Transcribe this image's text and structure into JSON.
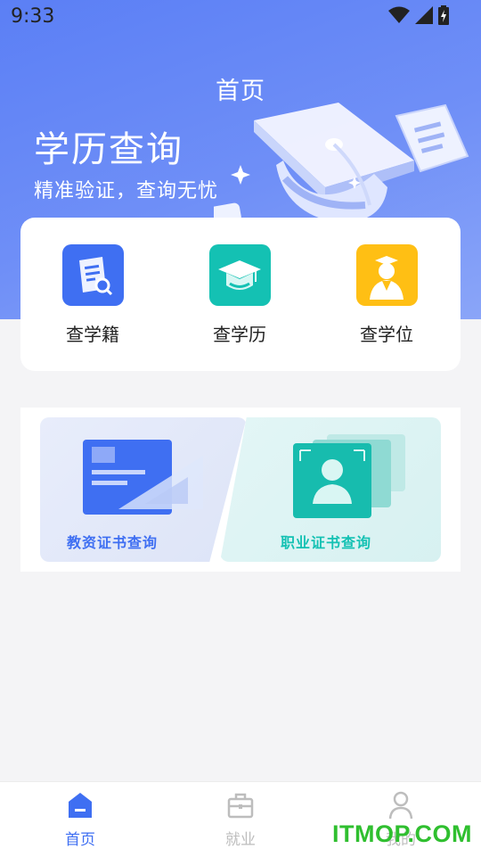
{
  "status_bar": {
    "time": "9:33"
  },
  "header": {
    "title": "首页"
  },
  "hero": {
    "title": "学历查询",
    "subtitle": "精准验证，查询无忧"
  },
  "quick_entries": [
    {
      "label": "查学籍",
      "icon": "document-search-icon",
      "color": "#3f6ff2"
    },
    {
      "label": "查学历",
      "icon": "graduation-cap-icon",
      "color": "#14c1b3"
    },
    {
      "label": "查学位",
      "icon": "graduate-person-icon",
      "color": "#ffbf14"
    }
  ],
  "banners": [
    {
      "label": "教资证书查询",
      "color": "#3f6ff2"
    },
    {
      "label": "职业证书查询",
      "color": "#14c1b3"
    }
  ],
  "tabbar": {
    "items": [
      {
        "label": "首页",
        "icon": "home-icon",
        "active": true
      },
      {
        "label": "就业",
        "icon": "briefcase-icon",
        "active": false
      },
      {
        "label": "我的",
        "icon": "person-icon",
        "active": false
      }
    ],
    "active_color": "#3f6ff2",
    "inactive_color": "#bdbdbd"
  },
  "watermark": "ITMOP.COM"
}
